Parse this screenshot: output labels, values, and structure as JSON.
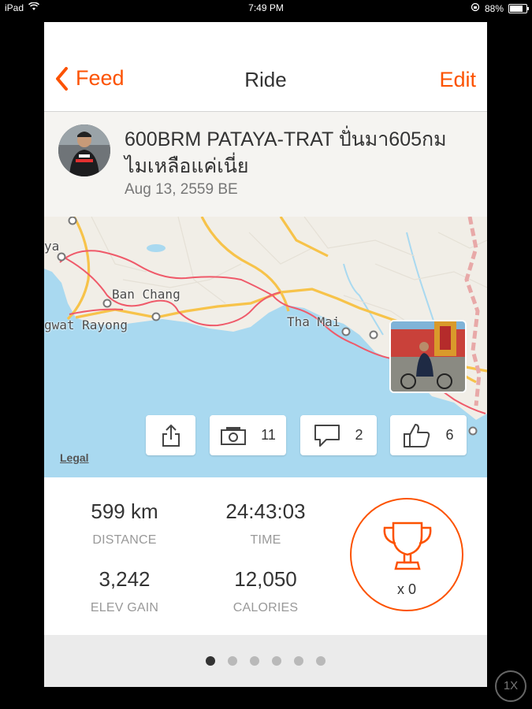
{
  "status_bar": {
    "device": "iPad",
    "time": "7:49 PM",
    "battery_text": "88%",
    "battery_level": 0.88,
    "icons": [
      "wifi-icon",
      "rotation-lock-icon",
      "battery-icon"
    ]
  },
  "nav": {
    "back_label": "Feed",
    "title": "Ride",
    "edit_label": "Edit"
  },
  "activity": {
    "title": "600BRM PATAYA-TRAT ปั่นมา605กม ไมเหลือแค่เนี่ย",
    "date": "Aug 13, 2559 BE"
  },
  "map": {
    "places": [
      "Ban Chang",
      "gwat Rayong",
      "ya",
      "Tha Mai"
    ],
    "legal_label": "Legal",
    "buttons": {
      "photos_count": "11",
      "comments_count": "2",
      "kudos_count": "6"
    }
  },
  "stats": {
    "distance_value": "599 km",
    "distance_label": "DISTANCE",
    "time_value": "24:43:03",
    "time_label": "TIME",
    "elev_value": "3,242",
    "elev_label": "ELEV GAIN",
    "calories_value": "12,050",
    "calories_label": "CALORIES",
    "achievements": "x 0"
  },
  "pager": {
    "count": 6,
    "active": 0
  },
  "zoom_label": "1X",
  "colors": {
    "accent": "#fc5200",
    "route": "#ef5a6a",
    "water": "#a9d9f0",
    "land": "#f1eee7",
    "road": "#f7c34a"
  }
}
